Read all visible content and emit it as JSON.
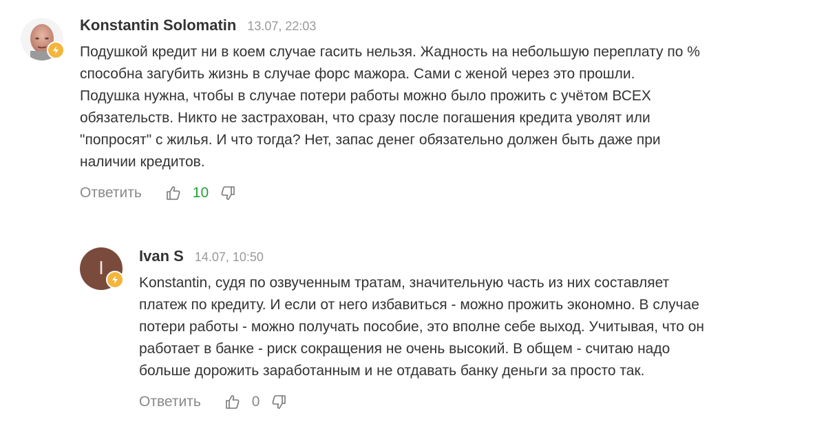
{
  "comments": [
    {
      "author": "Konstantin Solomatin",
      "time": "13.07, 22:03",
      "text": "Подушкой кредит ни в коем случае гасить нельзя. Жадность на небольшую переплату по %\nспособна загубить жизнь в случае форс мажора. Сами с женой через это прошли.\nПодушка нужна, чтобы в случае потери работы можно было прожить с учётом ВСЕХ\nобязательств. Никто не застрахован, что сразу после погашения кредита уволят или\n\"попросят\" с жилья. И что тогда? Нет, запас денег обязательно должен быть даже при\nналичии кредитов.",
      "reply_label": "Ответить",
      "score": "10"
    },
    {
      "author": "Ivan S",
      "avatar_letter": "I",
      "time": "14.07, 10:50",
      "text": "Konstantin, судя по озвученным тратам, значительную часть из них составляет\nплатеж по кредиту. И если от него избавиться - можно прожить экономно. В случае\nпотери работы - можно получать пособие, это вполне себе выход. Учитывая, что он\nработает в банке - риск сокращения не очень высокий. В общем - считаю надо\nбольше дорожить заработанным и не отдавать банку деньги за просто так.",
      "reply_label": "Ответить",
      "score": "0"
    }
  ],
  "colors": {
    "positive_score": "#21a038",
    "badge": "#f3b53b",
    "avatar_ivan": "#7a4a3c"
  },
  "icons": [
    "lightning-icon",
    "thumbs-up-icon",
    "thumbs-down-icon"
  ]
}
